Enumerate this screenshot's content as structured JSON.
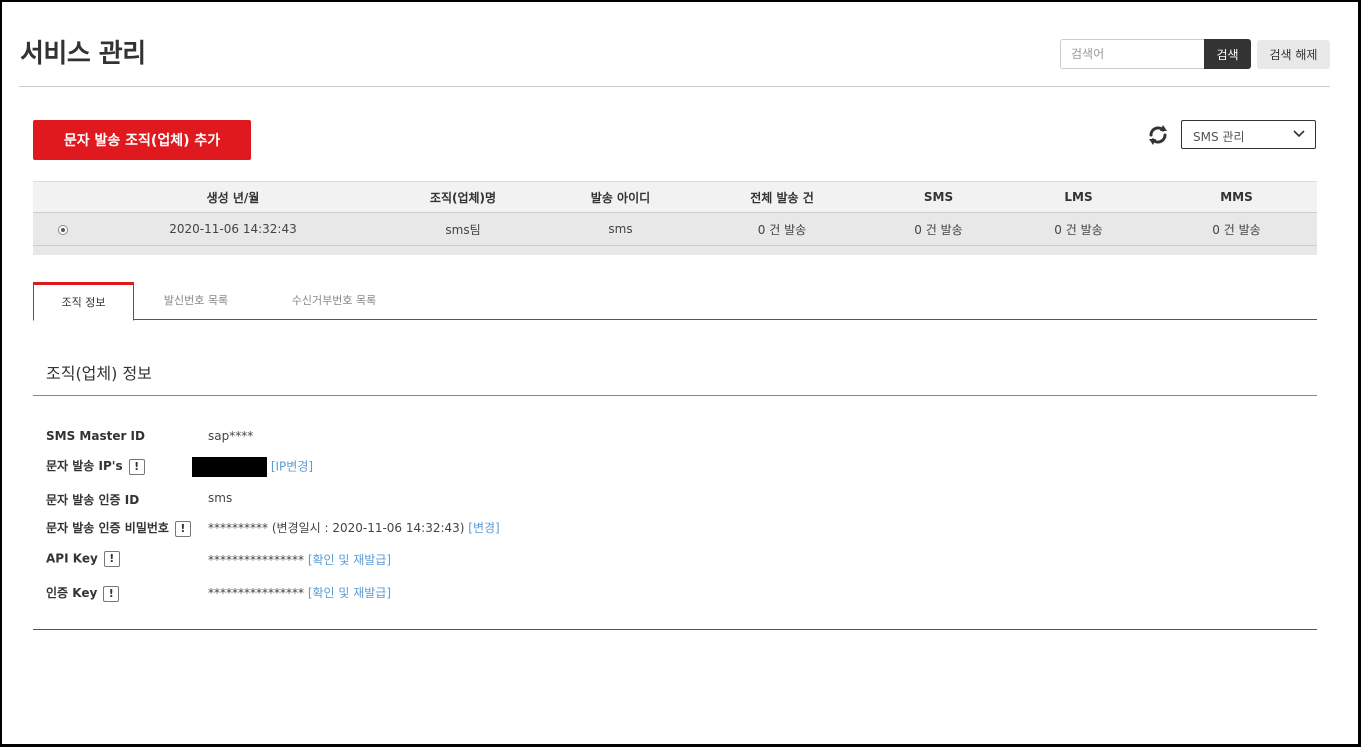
{
  "header": {
    "title": "서비스 관리",
    "search_placeholder": "검색어",
    "search_label": "검색",
    "clear_label": "검색 해제"
  },
  "toolbar": {
    "add_label": "문자 발송 조직(업체) 추가",
    "select_value": "SMS 관리"
  },
  "table": {
    "columns": [
      "생성 년/월",
      "조직(업체)명",
      "발송 아이디",
      "전체 발송 건",
      "SMS",
      "LMS",
      "MMS"
    ],
    "rows": [
      [
        "2020-11-06 14:32:43",
        "sms팀",
        "sms",
        "0 건 발송",
        "0 건 발송",
        "0 건 발송",
        "0 건 발송"
      ]
    ]
  },
  "tabs": [
    "조직 정보",
    "발신번호 목록",
    "수신거부번호 목록"
  ],
  "section": {
    "title": "조직(업체) 정보",
    "fields": [
      {
        "label": "SMS Master ID",
        "value": "sap****"
      },
      {
        "label": "문자 발송 IP's",
        "link": "[IP변경]"
      },
      {
        "label": "문자 발송 인증 ID",
        "value": "sms"
      },
      {
        "label": "문자 발송 인증 비밀번호",
        "value": "********** (변경일시 : 2020-11-06 14:32:43)",
        "link": "[변경]"
      },
      {
        "label": "API Key",
        "value": "****************",
        "link": "[확인 및 재발급]"
      },
      {
        "label": "인증 Key",
        "value": "****************",
        "link": "[확인 및 재발급]"
      }
    ]
  },
  "icons": {
    "refresh": "refresh-icon",
    "chevron": "chevron-down-icon",
    "info": "!"
  },
  "colors": {
    "accent": "#e0191f",
    "link": "#5b9bd5"
  }
}
